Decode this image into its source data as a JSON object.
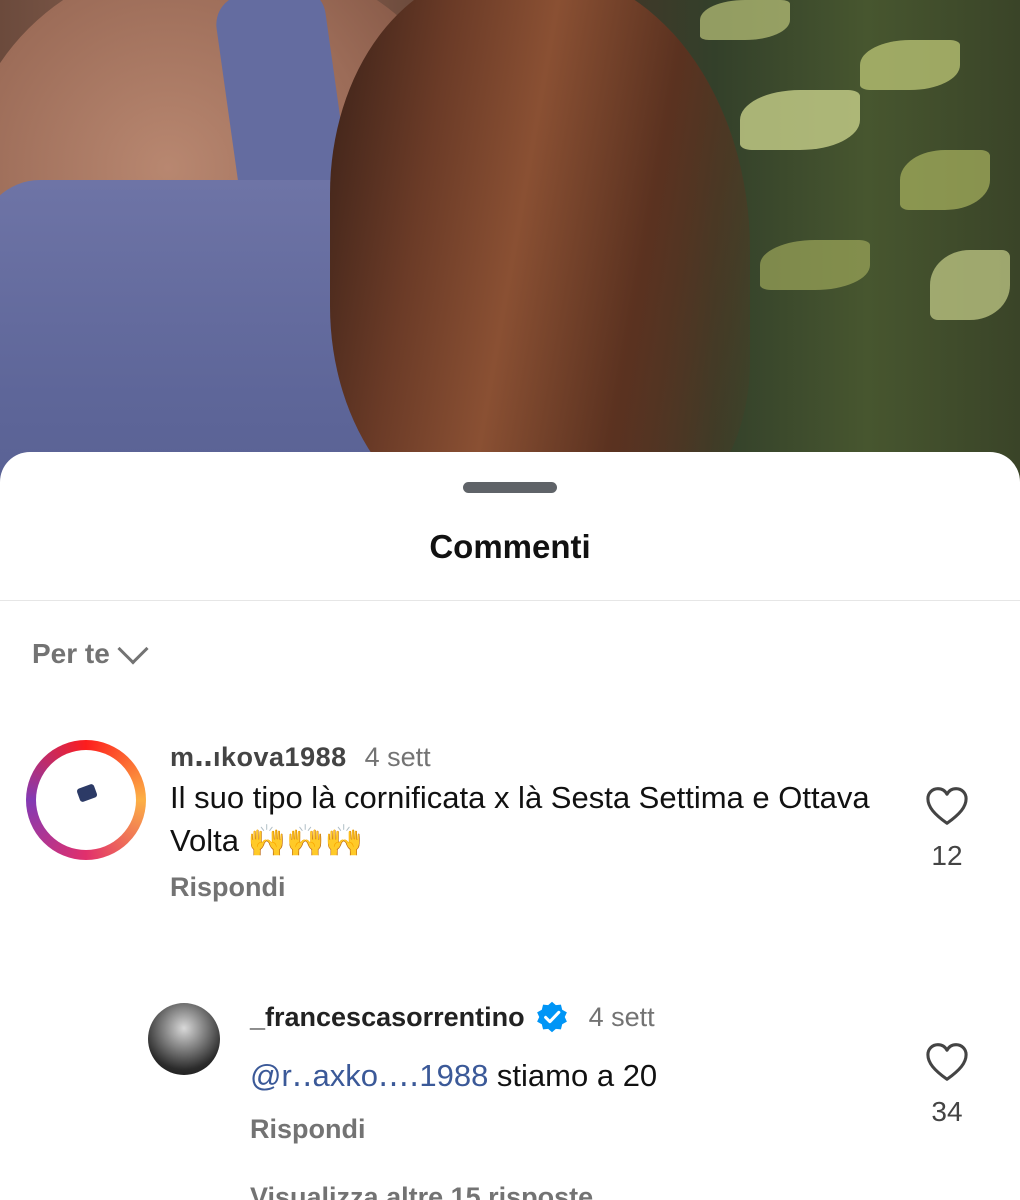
{
  "sheet": {
    "title": "Commenti",
    "sort_label": "Per te"
  },
  "comments": [
    {
      "username": "m‥ıkova1988",
      "time": "4 sett",
      "text": "Il suo tipo là cornificata x là Sesta Settima e Ottava Volta 🙌🙌🙌",
      "reply_label": "Rispondi",
      "likes": "12"
    },
    {
      "username": "_francescasorrentino",
      "verified": true,
      "time": "4 sett",
      "mention": "@r‥axko‥‥1988",
      "text": " stiamo a 20",
      "reply_label": "Rispondi",
      "likes": "34"
    }
  ],
  "more_replies": "Visualizza altre 15 risposte",
  "colors": {
    "verified_badge": "#0095f6",
    "secondary_text": "#737373",
    "mention": "#3b5998"
  },
  "icons": [
    "heart-outline-icon",
    "chevron-down-icon",
    "verified-badge-icon"
  ]
}
